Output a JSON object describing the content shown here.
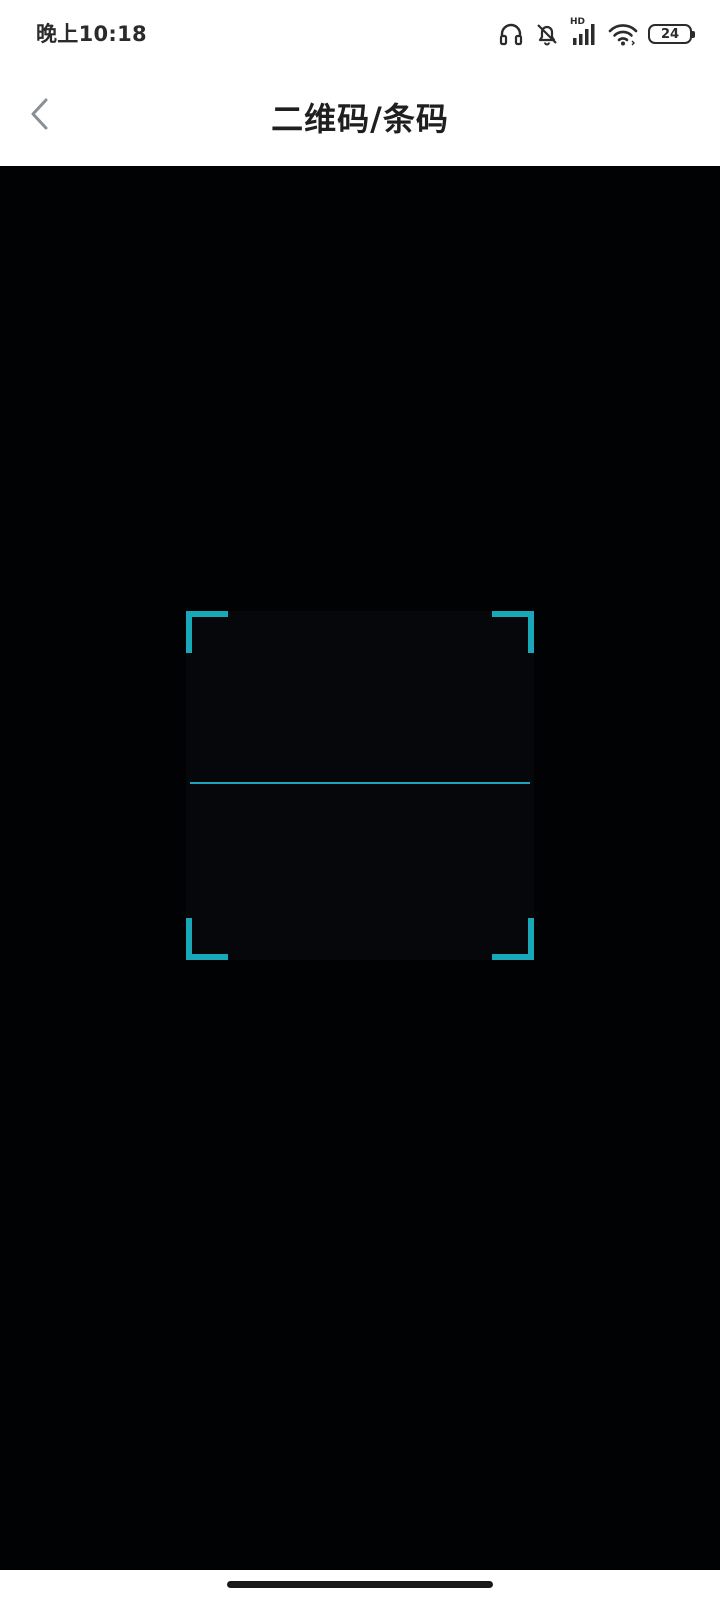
{
  "status_bar": {
    "time": "晚上10:18",
    "network_label": "HD",
    "battery": "24",
    "icons": [
      "headphones-icon",
      "mute-bell-icon",
      "signal-icon",
      "wifi-icon",
      "battery-icon"
    ]
  },
  "header": {
    "title": "二维码/条码",
    "back_icon": "chevron-left-icon"
  },
  "scanner": {
    "accent_color": "#19a8b8",
    "background_color": "#010203"
  },
  "colors": {
    "status_text": "#2b2b2b",
    "title_text": "#1f1f1f",
    "back_icon": "#8a8f94",
    "home_indicator": "#1a1a1a"
  }
}
